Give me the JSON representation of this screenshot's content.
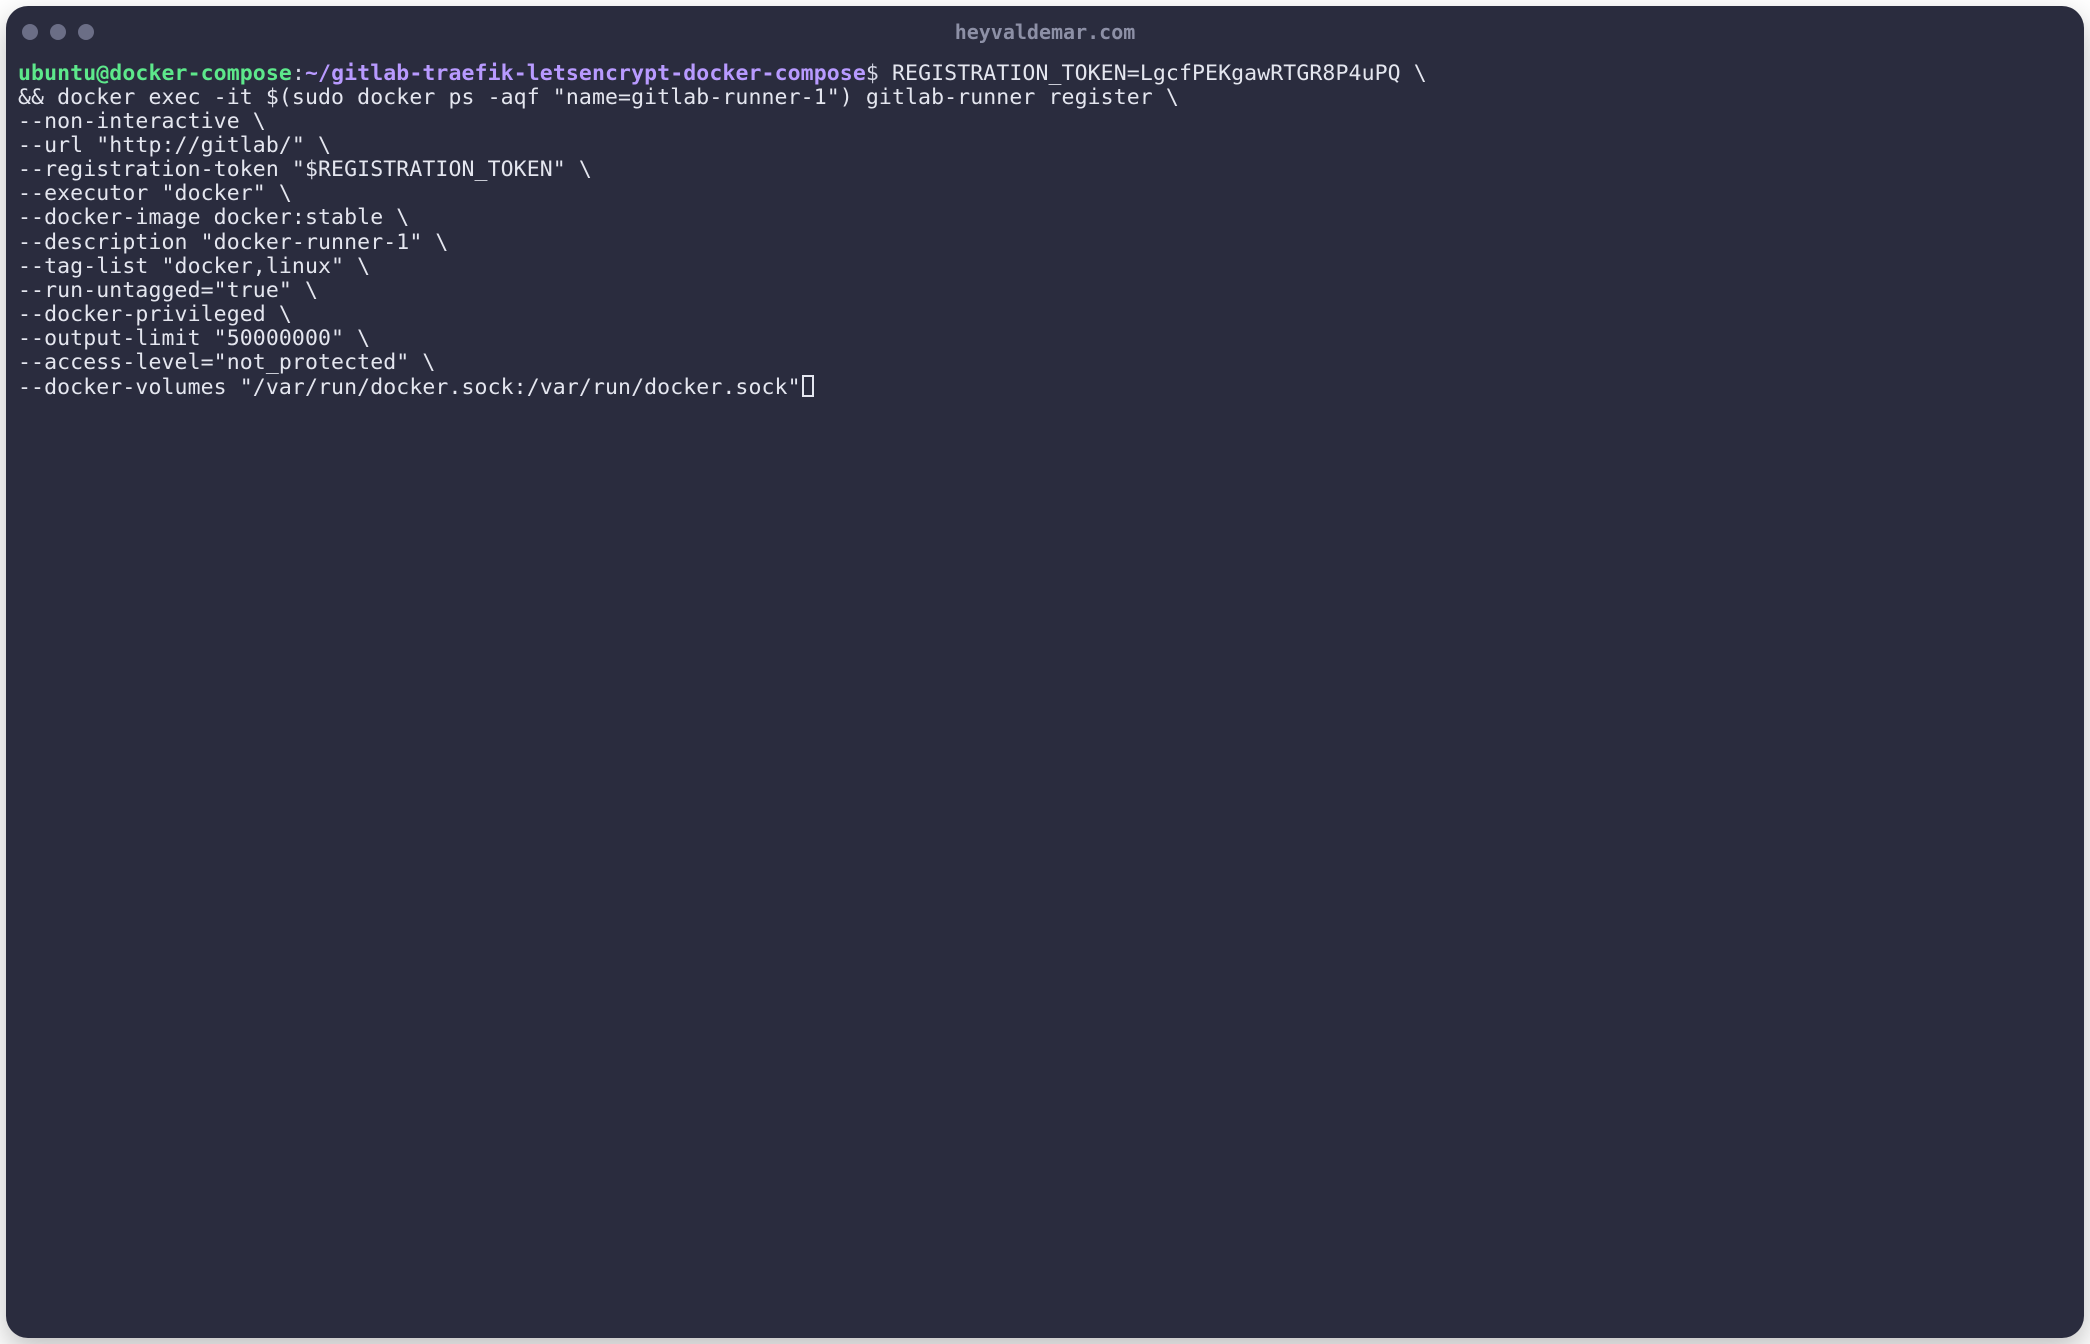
{
  "window": {
    "title": "heyvaldemar.com"
  },
  "prompt": {
    "user": "ubuntu@docker-compose",
    "colon": ":",
    "path": "~/gitlab-traefik-letsencrypt-docker-compose",
    "dollar": "$"
  },
  "command": {
    "line_first": " REGISTRATION_TOKEN=LgcfPEKgawRTGR8P4uPQ \\",
    "rest": "&& docker exec -it $(sudo docker ps -aqf \"name=gitlab-runner-1\") gitlab-runner register \\\n--non-interactive \\\n--url \"http://gitlab/\" \\\n--registration-token \"$REGISTRATION_TOKEN\" \\\n--executor \"docker\" \\\n--docker-image docker:stable \\\n--description \"docker-runner-1\" \\\n--tag-list \"docker,linux\" \\\n--run-untagged=\"true\" \\\n--docker-privileged \\\n--output-limit \"50000000\" \\\n--access-level=\"not_protected\" \\\n--docker-volumes \"/var/run/docker.sock:/var/run/docker.sock\""
  }
}
